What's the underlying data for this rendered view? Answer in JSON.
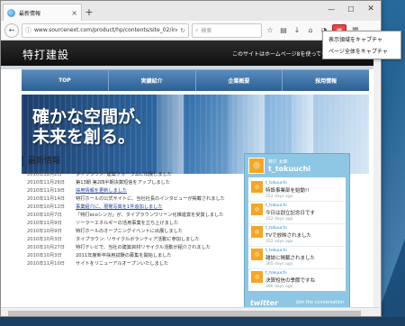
{
  "browser": {
    "tab_title": "最新情報",
    "tab_close": "×",
    "new_tab": "+",
    "url": "www.sourcenext.com/product/hp/contents/site_02/index.l",
    "search_placeholder": "検索",
    "controls": {
      "minimize": "—",
      "maximize": "☐",
      "close": "✕"
    }
  },
  "dropdown": {
    "items": [
      "表示領域をキャプチャ",
      "ページ全体をキャプチャ"
    ]
  },
  "site": {
    "logo": "特打建設",
    "header_note": "このサイトはホームページ8を使って作成したサンプルサイト",
    "nav": [
      "TOP",
      "実績紹介",
      "企業概要",
      "採用情報"
    ],
    "hero_line1": "確かな空間が、",
    "hero_line2": "未来を創る。"
  },
  "news": {
    "title": "最新情報",
    "items": [
      {
        "date": "2010年12月2日",
        "text": "タイプラウン: 建築フォーラムに出展しました",
        "link": false
      },
      {
        "date": "2010年11月26日",
        "text": "第13期 第2四半期決算短信をアップしました",
        "link": false
      },
      {
        "date": "2010年11月19日",
        "text": "採用情報を更新しました",
        "link": true
      },
      {
        "date": "2010年11月14日",
        "text": "特打ホールの公式サイトに、当社社長のインタビューが掲載されました",
        "link": false
      },
      {
        "date": "2010年10月12日",
        "text": "事業紹介に、現場写真を1件追加しました",
        "link": true
      },
      {
        "date": "2010年10月7日",
        "text": "「特打ecoシンガ」が、タイプラウンワリーン化推進賞を受賞しました",
        "link": false
      },
      {
        "date": "2010年11月9日",
        "text": "ソーラーエネルギーの活用事業を立ち上げました",
        "link": false
      },
      {
        "date": "2010年10月9日",
        "text": "特打ホールのオープニングイベントに出展しました",
        "link": false
      },
      {
        "date": "2010年10月3日",
        "text": "タイプラウン: リサイクルボランティア活動に参加しました",
        "link": false
      },
      {
        "date": "2010年10月27日",
        "text": "特打テレビで、当社の建築資材リサイクル活動が紹介されました",
        "link": false
      },
      {
        "date": "2010年10月3日",
        "text": "2011年度新卒採用試験の募集を開始しました",
        "link": false
      },
      {
        "date": "2010年11月10日",
        "text": "サイトをリニューアルオープンいたしました",
        "link": false
      }
    ]
  },
  "twitter": {
    "display_name": "特打 太郎",
    "handle": "t_tokuuchi",
    "tweets": [
      {
        "user": "t_tokuuchi",
        "text": "特設事業部を始動!!",
        "time": "352 days ago"
      },
      {
        "user": "t_tokuuchi",
        "text": "今日は創立記念日です",
        "time": "352 days ago"
      },
      {
        "user": "t_tokuuchi",
        "text": "TVで放映されました",
        "time": "352 days ago"
      },
      {
        "user": "t_tokuuchi",
        "text": "雑誌に掲載されました",
        "time": "385 days ago"
      },
      {
        "user": "t_tokuuchi",
        "text": "決算短信の季節ですね",
        "time": "386 days ago"
      }
    ],
    "logo": "twitter",
    "join": "Join the conversation"
  }
}
